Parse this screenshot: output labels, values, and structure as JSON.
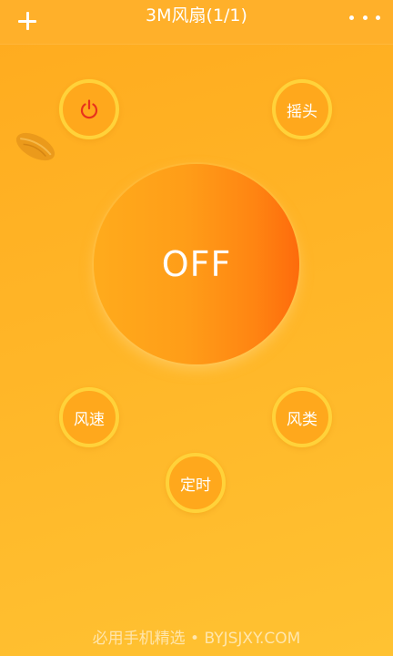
{
  "header": {
    "title": "3M风扇(1/1)"
  },
  "icons": {
    "add": "plus-icon",
    "more": "more-dots-icon",
    "power": "power-icon",
    "leaf": "leaf-icon"
  },
  "controls": {
    "dial_state": "OFF",
    "swing_label": "摇头",
    "speed_label": "风速",
    "mode_label": "风类",
    "timer_label": "定时"
  },
  "footer": {
    "watermark": "必用手机精选 • BYJSJXY.COM"
  },
  "colors": {
    "background": "#ffb527",
    "button_ring": "#ffd23a",
    "power_icon": "#e8321c",
    "dial_start": "#ffab1c",
    "dial_end": "#fd6b0c"
  }
}
